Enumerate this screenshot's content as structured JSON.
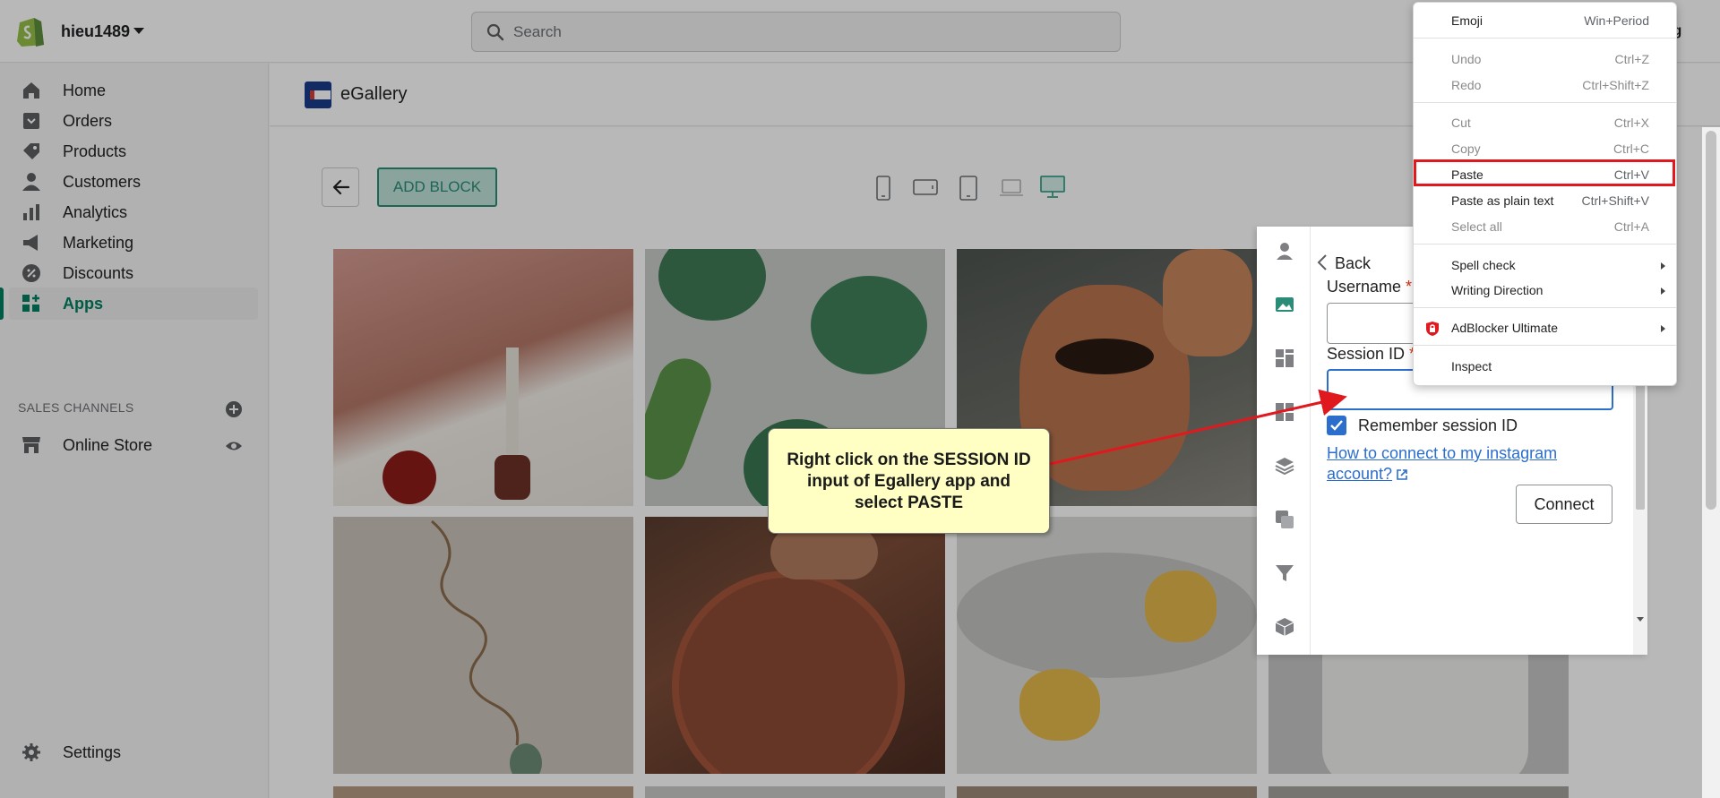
{
  "topbar": {
    "store_name": "hieu1489",
    "search_placeholder": "Search",
    "user_name": "ung"
  },
  "sidebar": {
    "items": [
      {
        "label": "Home",
        "icon": "home-icon"
      },
      {
        "label": "Orders",
        "icon": "orders-icon"
      },
      {
        "label": "Products",
        "icon": "products-icon"
      },
      {
        "label": "Customers",
        "icon": "customers-icon"
      },
      {
        "label": "Analytics",
        "icon": "analytics-icon"
      },
      {
        "label": "Marketing",
        "icon": "marketing-icon"
      },
      {
        "label": "Discounts",
        "icon": "discounts-icon"
      },
      {
        "label": "Apps",
        "icon": "apps-icon",
        "active": true
      }
    ],
    "sales_channels_title": "SALES CHANNELS",
    "online_store_label": "Online Store",
    "settings_label": "Settings"
  },
  "app": {
    "title": "eGallery",
    "add_block_label": "ADD BLOCK",
    "devices": [
      "mobile-portrait-icon",
      "mobile-landscape-icon",
      "tablet-icon",
      "laptop-icon",
      "desktop-icon"
    ]
  },
  "panel": {
    "back_label": "Back",
    "username_label": "Username",
    "session_label": "Session ID",
    "required_mark": "*",
    "remember_label": "Remember session ID",
    "remember_checked": true,
    "help_link": "How to connect to my instagram account?",
    "connect_label": "Connect"
  },
  "context_menu": {
    "items": [
      {
        "label": "Emoji",
        "shortcut": "Win+Period",
        "disabled": false
      },
      {
        "label": "Undo",
        "shortcut": "Ctrl+Z",
        "disabled": true
      },
      {
        "label": "Redo",
        "shortcut": "Ctrl+Shift+Z",
        "disabled": true
      },
      {
        "label": "Cut",
        "shortcut": "Ctrl+X",
        "disabled": true
      },
      {
        "label": "Copy",
        "shortcut": "Ctrl+C",
        "disabled": true
      },
      {
        "label": "Paste",
        "shortcut": "Ctrl+V",
        "disabled": false,
        "highlighted": true
      },
      {
        "label": "Paste as plain text",
        "shortcut": "Ctrl+Shift+V",
        "disabled": false
      },
      {
        "label": "Select all",
        "shortcut": "Ctrl+A",
        "disabled": true
      },
      {
        "label": "Spell check",
        "submenu": true
      },
      {
        "label": "Writing Direction",
        "submenu": true
      },
      {
        "label": "AdBlocker Ultimate",
        "submenu": true
      },
      {
        "label": "Inspect"
      }
    ]
  },
  "annotation": {
    "text": "Right click on  the SESSION ID input of Egallery app and select PASTE"
  },
  "colors": {
    "accent": "#008060",
    "link": "#2c6ecb",
    "highlight_border": "#e0191f",
    "callout_bg": "#ffffc4"
  }
}
